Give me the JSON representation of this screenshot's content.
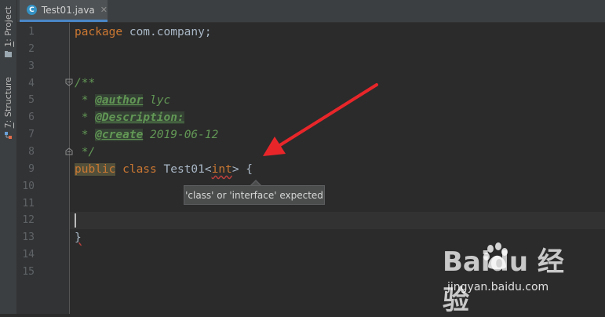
{
  "tool_window_strip": {
    "project_label_num": "1",
    "project_label": ": Project",
    "structure_label_num": "7",
    "structure_label": ": Structure"
  },
  "editor_tab": {
    "icon_letter": "C",
    "title": "Test01.java",
    "close_glyph": "✕"
  },
  "line_numbers": [
    "1",
    "2",
    "3",
    "4",
    "5",
    "6",
    "7",
    "8",
    "9",
    "10",
    "11",
    "12",
    "13",
    "14",
    "15"
  ],
  "code": {
    "line1_kw": "package",
    "line1_rest": " com.company;",
    "line4": "/**",
    "line5_star": " * ",
    "line5_tag": "@author",
    "line5_val": " lyc",
    "line6_star": " * ",
    "line6_tag": "@Description:",
    "line7_star": " * ",
    "line7_tag": "@create",
    "line7_val": " 2019-06-12",
    "line8": " */",
    "line9_kw1": "public",
    "line9_kw2": " class",
    "line9_name": " Test01<",
    "line9_err": "int",
    "line9_gt": ">",
    "line9_brace": " {",
    "line13": "}"
  },
  "tooltip": {
    "message": "'class' or 'interface' expected"
  },
  "watermark": {
    "brand": "Baidu 经验",
    "url": "jingyan.baidu.com"
  },
  "colors": {
    "annotation_arrow": "#e8262a"
  }
}
